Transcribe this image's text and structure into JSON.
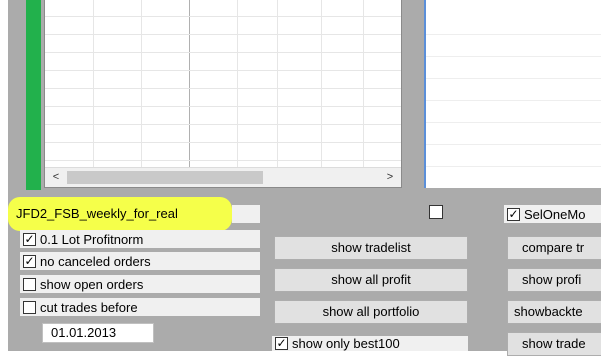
{
  "strategy": {
    "name": "JFD2_FSB_weekly_for_real"
  },
  "options": [
    {
      "label": "0.1 Lot Profitnorm",
      "checked": true
    },
    {
      "label": "no canceled orders",
      "checked": true
    },
    {
      "label": "show open orders",
      "checked": false
    },
    {
      "label": "cut trades before",
      "checked": false
    }
  ],
  "cut_date": "01.01.2013",
  "middle_buttons": {
    "tradelist": "show tradelist",
    "all_profit": "show all profit",
    "all_portfolio": "show all portfolio"
  },
  "best100": {
    "label": "show only best100",
    "checked": true
  },
  "right_column": {
    "selone": {
      "label": "SelOneMo",
      "checked": true
    },
    "compare": "compare tr",
    "profit": "show profi",
    "backtest": "showbackte",
    "trades": "show trade"
  },
  "scroll": {
    "left": "<",
    "right": ">"
  },
  "colors": {
    "accent_green": "#22b14c",
    "highlight": "#f5ff4a"
  }
}
